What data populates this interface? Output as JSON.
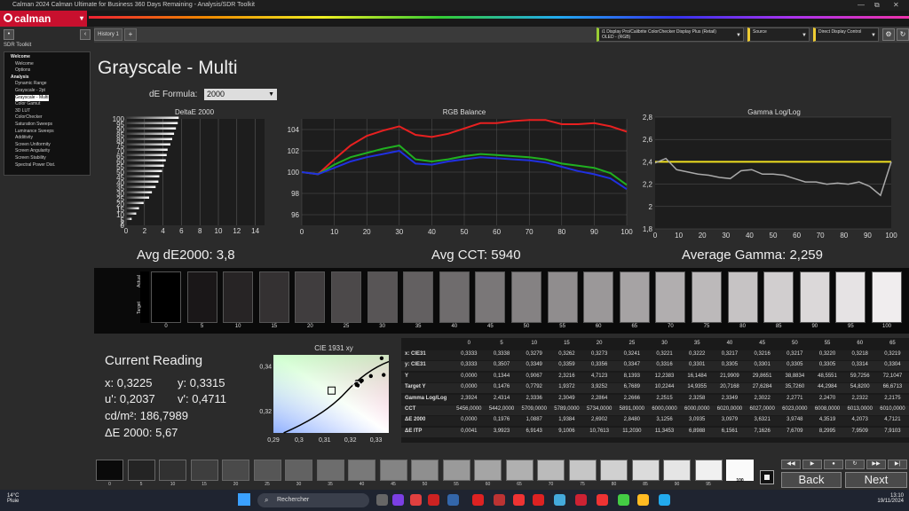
{
  "window": {
    "title": "Calman 2024 Calman Ultimate for Business 360 Days Remaining - Analysis/SDR Toolkit",
    "min": "—",
    "max": "⧉",
    "close": "✕"
  },
  "app": {
    "logo": "calman"
  },
  "sidebar": {
    "toolkit_label": "SDR Toolkit",
    "items": [
      {
        "label": "Welcome",
        "header": true
      },
      {
        "label": "Welcome"
      },
      {
        "label": "Options"
      },
      {
        "label": "Analysis",
        "header": true
      },
      {
        "label": "Dynamic Range"
      },
      {
        "label": "Grayscale - 2pt"
      },
      {
        "label": "Grayscale - Multi",
        "selected": true
      },
      {
        "label": "Color Gamut"
      },
      {
        "label": "3D LUT"
      },
      {
        "label": "ColorChecker"
      },
      {
        "label": "Saturation Sweeps"
      },
      {
        "label": "Luminance Sweeps"
      },
      {
        "label": "Additivity"
      },
      {
        "label": "Screen Uniformity"
      },
      {
        "label": "Screen Angularity"
      },
      {
        "label": "Screen Stability"
      },
      {
        "label": "Spectral Power Dist."
      }
    ]
  },
  "tabs": {
    "history": "History 1",
    "add": "+"
  },
  "devices": {
    "meter_line1": "i1 Display Pro/Calibrite ColorChecker Display Plus (Retail)",
    "meter_line2": "OLED - (RGB)",
    "source": "Source",
    "display_control": "Direct Display Control"
  },
  "page": {
    "title": "Grayscale - Multi",
    "de_formula_label": "dE Formula:",
    "de_formula_value": "2000"
  },
  "charts": {
    "delta": {
      "title": "DeltaE 2000",
      "summary": "Avg dE2000: 3,8"
    },
    "rgb": {
      "title": "RGB Balance",
      "summary": "Avg CCT: 5940"
    },
    "gamma": {
      "title": "Gamma Log/Log",
      "summary": "Average Gamma: 2,259"
    }
  },
  "chart_data": [
    {
      "type": "bar",
      "title": "DeltaE 2000",
      "orientation": "horizontal",
      "categories": [
        "0",
        "5",
        "10",
        "15",
        "20",
        "25",
        "30",
        "35",
        "40",
        "45",
        "50",
        "55",
        "60",
        "65",
        "70",
        "75",
        "80",
        "85",
        "90",
        "95",
        "100"
      ],
      "values": [
        0,
        0.6,
        1.1,
        1.4,
        1.9,
        2.5,
        2.8,
        3.2,
        3.5,
        3.6,
        3.9,
        4.1,
        4.3,
        4.4,
        4.5,
        4.8,
        5.0,
        5.2,
        5.4,
        5.6,
        5.7
      ],
      "xlim": [
        0,
        15
      ],
      "ylim": [
        0,
        100
      ],
      "xticks": [
        "0",
        "2",
        "4",
        "6",
        "8",
        "10",
        "12",
        "14"
      ],
      "yticks": [
        "0",
        "2",
        "5",
        "10",
        "15",
        "20",
        "25",
        "30",
        "35",
        "40",
        "45",
        "50",
        "55",
        "60",
        "65",
        "70",
        "75",
        "80",
        "85",
        "90",
        "95",
        "100"
      ]
    },
    {
      "type": "line",
      "title": "RGB Balance",
      "x": [
        0,
        5,
        10,
        15,
        20,
        25,
        30,
        35,
        40,
        45,
        50,
        55,
        60,
        65,
        70,
        75,
        80,
        85,
        90,
        95,
        100
      ],
      "xlim": [
        0,
        100
      ],
      "ylim": [
        95,
        105
      ],
      "yticks": [
        "96",
        "98",
        "100",
        "102",
        "104"
      ],
      "xticks": [
        "0",
        "10",
        "20",
        "30",
        "40",
        "50",
        "60",
        "70",
        "80",
        "90",
        "100"
      ],
      "series": [
        {
          "name": "R",
          "color": "#e82020",
          "values": [
            100,
            99.8,
            101.2,
            102.5,
            103.4,
            103.9,
            104.3,
            103.5,
            103.3,
            103.6,
            104.1,
            104.6,
            104.6,
            104.8,
            104.9,
            104.9,
            104.5,
            104.5,
            104.6,
            104.3,
            103.8
          ]
        },
        {
          "name": "G",
          "color": "#20b020",
          "values": [
            100,
            99.8,
            100.7,
            101.4,
            101.8,
            102.2,
            102.5,
            101.2,
            101.0,
            101.2,
            101.5,
            101.7,
            101.6,
            101.5,
            101.4,
            101.2,
            100.8,
            100.6,
            100.4,
            99.9,
            98.8
          ]
        },
        {
          "name": "B",
          "color": "#2030e0",
          "values": [
            100,
            99.8,
            100.4,
            101.0,
            101.4,
            101.7,
            102.0,
            100.8,
            100.7,
            101.0,
            101.2,
            101.4,
            101.3,
            101.2,
            101.1,
            100.9,
            100.5,
            100.1,
            99.8,
            99.4,
            98.4
          ]
        }
      ]
    },
    {
      "type": "line",
      "title": "Gamma Log/Log",
      "x": [
        0,
        5,
        10,
        15,
        20,
        25,
        30,
        35,
        40,
        45,
        50,
        55,
        60,
        65,
        70,
        75,
        80,
        85,
        90,
        95,
        100
      ],
      "xlim": [
        0,
        100
      ],
      "ylim": [
        1.8,
        2.8
      ],
      "yticks": [
        "1,8",
        "2",
        "2,2",
        "2,4",
        "2,6",
        "2,8"
      ],
      "xticks": [
        "0",
        "10",
        "20",
        "30",
        "40",
        "50",
        "60",
        "70",
        "80",
        "90",
        "100"
      ],
      "target": 2.4,
      "series": [
        {
          "name": "Gamma",
          "color": "#aaaaaa",
          "values": [
            2.39,
            2.43,
            2.33,
            2.31,
            2.29,
            2.28,
            2.26,
            2.25,
            2.32,
            2.33,
            2.29,
            2.29,
            2.28,
            2.25,
            2.22,
            2.22,
            2.2,
            2.21,
            2.2,
            2.22,
            2.18,
            2.1,
            2.4
          ]
        },
        {
          "name": "Target",
          "color": "#f0e020",
          "values": [
            2.4,
            2.4
          ]
        }
      ]
    },
    {
      "type": "scatter",
      "title": "CIE 1931 xy",
      "xlim": [
        0.29,
        0.335
      ],
      "ylim": [
        0.31,
        0.345
      ],
      "xticks": [
        "0,29",
        "0,3",
        "0,31",
        "0,32",
        "0,33"
      ],
      "yticks": [
        "0,32",
        "0,34"
      ]
    }
  ],
  "swatches": {
    "labels": [
      "Actual",
      "Target"
    ],
    "steps": [
      "0",
      "5",
      "10",
      "15",
      "20",
      "25",
      "30",
      "35",
      "40",
      "45",
      "50",
      "55",
      "60",
      "65",
      "70",
      "75",
      "80",
      "85",
      "90",
      "95",
      "100"
    ]
  },
  "reading": {
    "title": "Current Reading",
    "x": "x: 0,3225",
    "y": "y: 0,3315",
    "u": "u': 0,2037",
    "v": "v': 0,4711",
    "cd": "cd/m²: 186,7989",
    "de": "ΔE 2000: 5,67"
  },
  "cie": {
    "title": "CIE 1931 xy"
  },
  "table": {
    "columns": [
      "0",
      "5",
      "10",
      "15",
      "20",
      "25",
      "30",
      "35",
      "40",
      "45",
      "50",
      "55",
      "60",
      "65"
    ],
    "rows": [
      {
        "label": "x: CIE31",
        "values": [
          "0,3333",
          "0,3338",
          "0,3279",
          "0,3262",
          "0,3273",
          "0,3241",
          "0,3221",
          "0,3222",
          "0,3217",
          "0,3216",
          "0,3217",
          "0,3220",
          "0,3218",
          "0,3219"
        ]
      },
      {
        "label": "y: CIE31",
        "values": [
          "0,3333",
          "0,3507",
          "0,3349",
          "0,3359",
          "0,3356",
          "0,3347",
          "0,3316",
          "0,3301",
          "0,3305",
          "0,3301",
          "0,3305",
          "0,3305",
          "0,3314",
          "0,3304"
        ]
      },
      {
        "label": "Y",
        "values": [
          "0,0000",
          "0,1344",
          "0,9067",
          "2,3216",
          "4,7123",
          "8,1393",
          "12,2383",
          "16,1484",
          "21,9909",
          "29,8651",
          "38,8834",
          "48,5551",
          "59,7256",
          "72,1047"
        ]
      },
      {
        "label": "Target Y",
        "values": [
          "0,0000",
          "0,1476",
          "0,7792",
          "1,9372",
          "3,9252",
          "6,7689",
          "10,2244",
          "14,9355",
          "20,7168",
          "27,6284",
          "35,7260",
          "44,2984",
          "54,8200",
          "66,6713"
        ]
      },
      {
        "label": "Gamma Log/Log",
        "values": [
          "2,3924",
          "2,4314",
          "2,3336",
          "2,3049",
          "2,2864",
          "2,2666",
          "2,2515",
          "2,3258",
          "2,3349",
          "2,3022",
          "2,2771",
          "2,2470",
          "2,2322",
          "2,2175"
        ]
      },
      {
        "label": "CCT",
        "values": [
          "5456,0000",
          "5442,0000",
          "5709,0000",
          "5789,0000",
          "5734,0000",
          "5891,0000",
          "6000,0000",
          "6000,0000",
          "6020,0000",
          "6027,0000",
          "6023,0000",
          "6008,0000",
          "6013,0000",
          "6010,0000"
        ]
      },
      {
        "label": "ΔE 2000",
        "values": [
          "0,0000",
          "0,1976",
          "1,0887",
          "1,9384",
          "2,6902",
          "2,8480",
          "3,1256",
          "3,0935",
          "3,0979",
          "3,6321",
          "3,9748",
          "4,3519",
          "4,2073",
          "4,7121"
        ]
      },
      {
        "label": "ΔE ITP",
        "values": [
          "0,0041",
          "3,9923",
          "6,9143",
          "9,1006",
          "10,7613",
          "11,2030",
          "11,3453",
          "6,8988",
          "6,1561",
          "7,1626",
          "7,6709",
          "8,2995",
          "7,9509",
          "7,9103"
        ]
      }
    ]
  },
  "bottom": {
    "steps": [
      "0",
      "5",
      "10",
      "15",
      "20",
      "25",
      "30",
      "35",
      "40",
      "45",
      "50",
      "55",
      "60",
      "65",
      "70",
      "75",
      "80",
      "85",
      "90",
      "95",
      "100"
    ],
    "back": "Back",
    "next": "Next"
  },
  "taskbar": {
    "temp": "14°C",
    "weather": "Pluie",
    "search": "Rechercher",
    "time": "13:10",
    "date": "19/11/2024"
  }
}
